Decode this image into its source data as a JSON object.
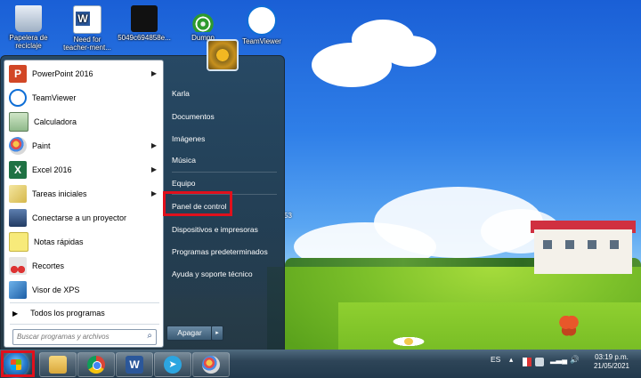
{
  "desktop": {
    "icons": [
      {
        "label_line1": "Papelera de",
        "label_line2": "reciclaje",
        "icon": "recycle-bin-icon"
      },
      {
        "label_line1": "Need for",
        "label_line2": "teacher-ment...",
        "icon": "word-document-icon"
      },
      {
        "label_line1": "5049c694858e...",
        "label_line2": "",
        "icon": "image-file-icon"
      },
      {
        "label_line1": "Dumpp",
        "label_line2": "",
        "icon": "wifi-app-icon"
      },
      {
        "label_line1": "TeamViewer",
        "label_line2": "",
        "icon": "teamviewer-icon"
      }
    ],
    "stray_text": "53"
  },
  "start_menu": {
    "programs": [
      {
        "label": "PowerPoint 2016",
        "icon": "powerpoint-icon",
        "has_submenu": true
      },
      {
        "label": "TeamViewer",
        "icon": "teamviewer-icon",
        "has_submenu": false
      },
      {
        "label": "Calculadora",
        "icon": "calculator-icon",
        "has_submenu": false
      },
      {
        "label": "Paint",
        "icon": "paint-icon",
        "has_submenu": true
      },
      {
        "label": "Excel 2016",
        "icon": "excel-icon",
        "has_submenu": true
      },
      {
        "label": "Tareas iniciales",
        "icon": "getting-started-icon",
        "has_submenu": true
      },
      {
        "label": "Conectarse a un proyector",
        "icon": "projector-icon",
        "has_submenu": false
      },
      {
        "label": "Notas rápidas",
        "icon": "sticky-notes-icon",
        "has_submenu": false
      },
      {
        "label": "Recortes",
        "icon": "snipping-tool-icon",
        "has_submenu": false
      },
      {
        "label": "Visor de XPS",
        "icon": "xps-viewer-icon",
        "has_submenu": false
      }
    ],
    "all_programs_label": "Todos los programas",
    "search_placeholder": "Buscar programas y archivos",
    "right_items": [
      "Karla",
      "Documentos",
      "Imágenes",
      "Música",
      "Equipo",
      "Panel de control",
      "Dispositivos e impresoras",
      "Programas predeterminados",
      "Ayuda y soporte técnico"
    ],
    "highlighted_item": "Panel de control",
    "shutdown_label": "Apagar",
    "shutdown_arrow": "▸"
  },
  "taskbar": {
    "pinned": [
      "file-explorer-icon",
      "chrome-icon",
      "word-icon",
      "telegram-icon",
      "paint-icon"
    ],
    "tray": {
      "language": "ES",
      "time": "03:19 p.m.",
      "date": "21/05/2021"
    }
  },
  "colors": {
    "highlight_border": "#e0101c",
    "taskbar": "#2e4558"
  }
}
